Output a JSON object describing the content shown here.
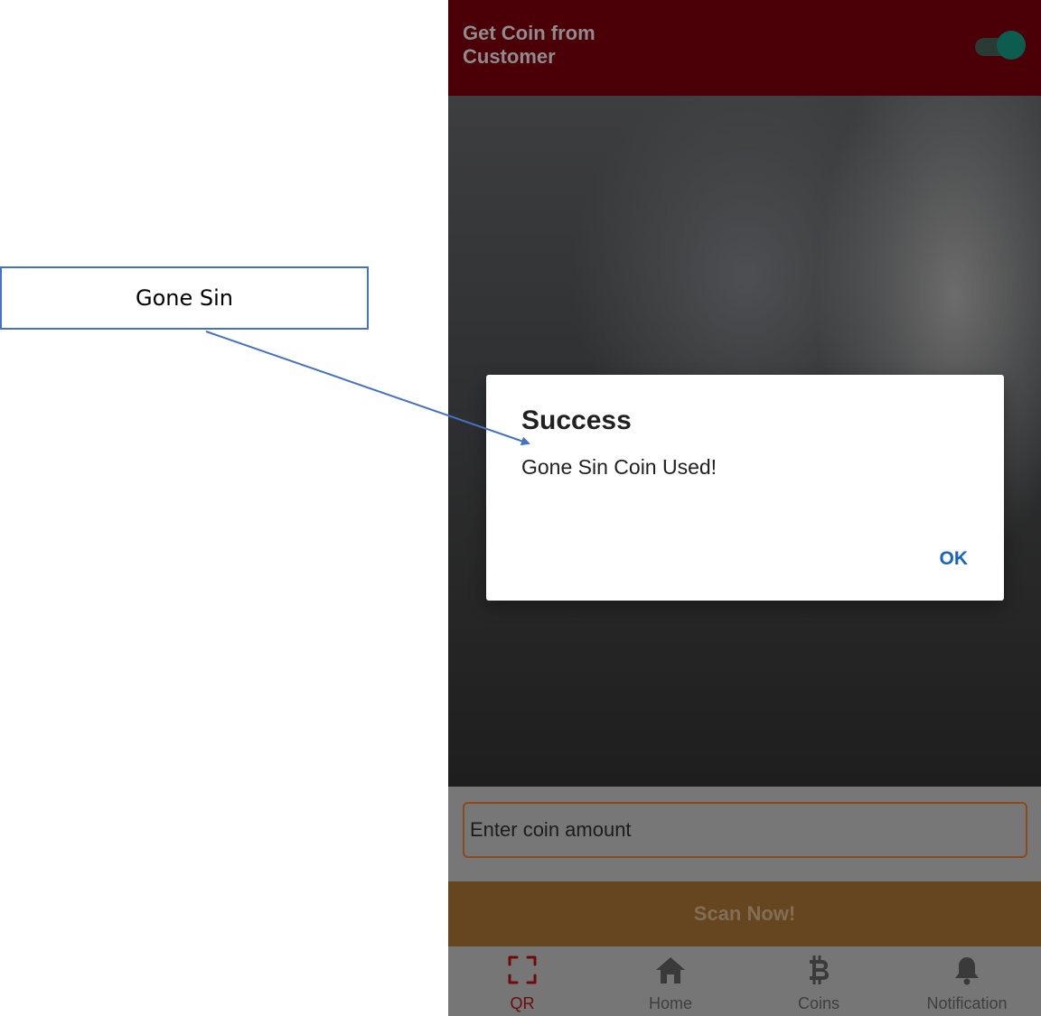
{
  "annotation": {
    "label": "Gone Sin",
    "color": "#4472c4"
  },
  "header": {
    "title": "Get Coin from Customer",
    "background": "#4a0006",
    "toggle_on": true
  },
  "input": {
    "placeholder": "Enter coin amount",
    "value": ""
  },
  "scan_button": {
    "label": "Scan Now!"
  },
  "bottom_nav": {
    "items": [
      {
        "label": "QR",
        "icon": "qr-scan-icon",
        "active": true
      },
      {
        "label": "Home",
        "icon": "home-icon",
        "active": false
      },
      {
        "label": "Coins",
        "icon": "bitcoin-icon",
        "active": false
      },
      {
        "label": "Notification",
        "icon": "bell-icon",
        "active": false
      }
    ]
  },
  "dialog": {
    "title": "Success",
    "message": "Gone Sin Coin Used!",
    "ok_label": "OK"
  },
  "colors": {
    "accent": "#1565c0",
    "active_nav": "#6e0a0a",
    "input_border": "#8a4a1d",
    "scan_button": "#664521"
  }
}
